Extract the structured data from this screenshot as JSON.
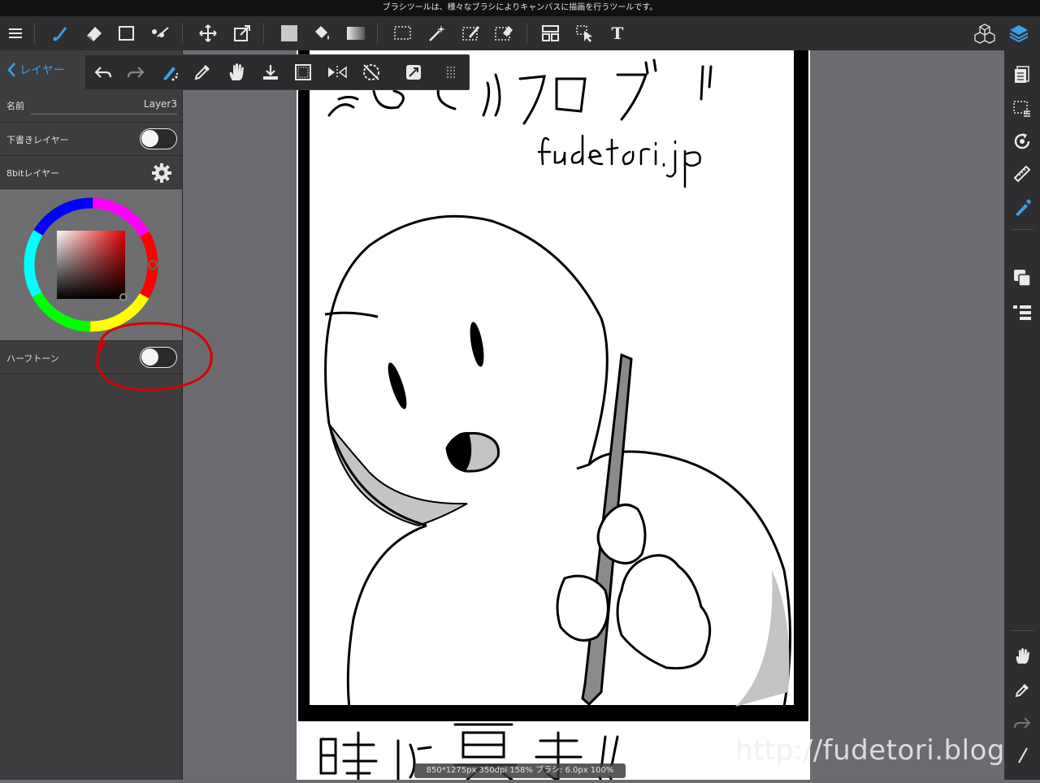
{
  "tooltip": "ブラシツールは、様々なブラシによりキャンバスに描画を行うツールです。",
  "toolbar": {
    "menu_icon": "menu-icon",
    "tools": [
      "brush-icon",
      "eraser-icon",
      "rectangle-icon",
      "dot-icon",
      "move-icon",
      "transform-icon",
      "fill-color-icon",
      "bucket-icon",
      "gradient-icon",
      "select-rect-icon",
      "magic-wand-icon",
      "select-pen-icon",
      "select-eraser-icon",
      "panel-layout-icon",
      "select-object-icon",
      "text-icon",
      "3d-icon",
      "layers-icon"
    ],
    "text_tool_label": "T"
  },
  "float_toolbar": {
    "tools": [
      "undo-icon",
      "redo-icon",
      "airbrush-icon",
      "eyedropper-icon",
      "hand-icon",
      "save-icon",
      "fill-frame-icon",
      "flip-icon",
      "rotate-reset-icon",
      "snap-icon",
      "grip-icon"
    ]
  },
  "left_panel": {
    "back_label": "レイヤー",
    "name_label": "名前",
    "name_value": "Layer3",
    "draft_layer_label": "下書きレイヤー",
    "bit_layer_label": "8bitレイヤー",
    "halftone_label": "ハーフトーン",
    "draft_on": false,
    "halftone_on": false,
    "color_accent": "#b00000"
  },
  "right_panel": {
    "tools": [
      "page-icon",
      "select-show-icon",
      "rotate-icon",
      "ruler-icon",
      "snap-pen-icon",
      "layer-copy-icon",
      "layer-list-icon",
      "hand-icon",
      "eyedropper-icon",
      "redo-icon",
      "slash-icon"
    ]
  },
  "canvas": {
    "title_text": "ふでとりブログ",
    "url_text": "fudetori.jp",
    "panel2_text": "時は暮ま!!"
  },
  "status": "850*1275px 350dpi 158% ブラシ: 6.0px 100%",
  "watermark": "http://fudetori.blog.jp/"
}
